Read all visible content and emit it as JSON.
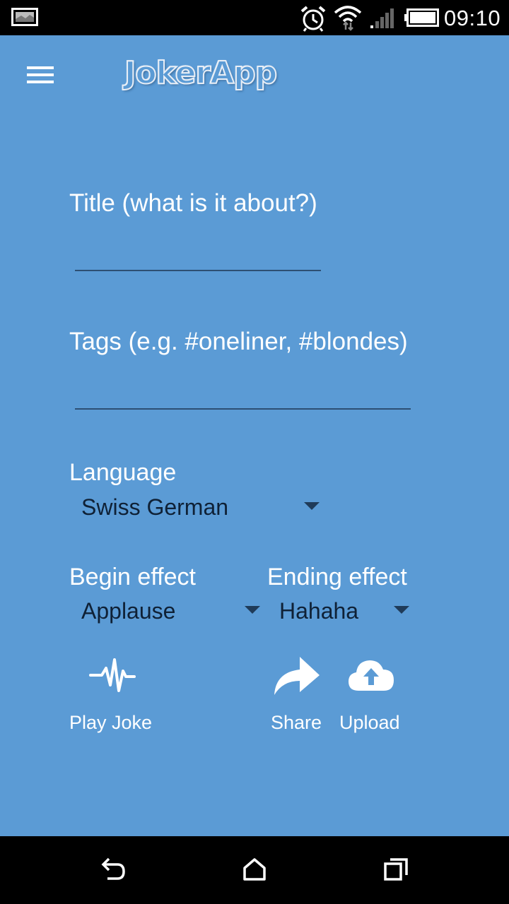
{
  "status_bar": {
    "time": "09:10",
    "icons": [
      "gallery-icon",
      "alarm-icon",
      "wifi-icon",
      "signal-icon",
      "battery-icon"
    ]
  },
  "app_bar": {
    "menu_icon": "hamburger-menu-icon",
    "logo_text": "JokerApp"
  },
  "form": {
    "title_field": {
      "placeholder": "Title (what is it about?)",
      "value": ""
    },
    "tags_field": {
      "placeholder": "Tags (e.g. #oneliner, #blondes)",
      "value": ""
    },
    "language": {
      "label": "Language",
      "selected": "Swiss German"
    },
    "begin_effect": {
      "label": "Begin effect",
      "selected": "Applause"
    },
    "ending_effect": {
      "label": "Ending effect",
      "selected": "Hahaha"
    }
  },
  "actions": {
    "play": {
      "label": "Play Joke",
      "icon": "waveform-icon"
    },
    "share": {
      "label": "Share",
      "icon": "share-arrow-icon"
    },
    "upload": {
      "label": "Upload",
      "icon": "cloud-upload-icon"
    }
  },
  "nav_bar": {
    "icons": [
      "back-icon",
      "home-icon",
      "recents-icon"
    ]
  },
  "colors": {
    "background": "#5b9bd5",
    "bars": "#000000",
    "text_light": "#ffffff",
    "text_dark": "#0f2136",
    "underline": "#2d4f73"
  }
}
